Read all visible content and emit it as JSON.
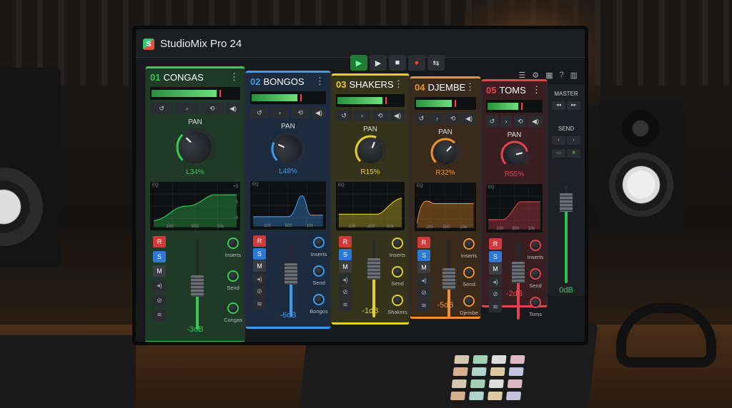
{
  "app": {
    "title": "StudioMix Pro 24",
    "logo_letter": "S"
  },
  "transport": {
    "play": "▶",
    "play2": "▶",
    "stop": "■",
    "record": "●",
    "loop": "⇆"
  },
  "top_icons": [
    "list-icon",
    "gear-icon",
    "layout-icon",
    "help-icon",
    "panels-icon"
  ],
  "channels": [
    {
      "num": "01",
      "name": "CONGAS",
      "color": "#35c956",
      "bg": "#1f3a27",
      "pan_label": "PAN",
      "pan_value": "L34%",
      "pan_level": 0.33,
      "meter_level": 0.72,
      "db": "-3dB",
      "knob_labels": [
        "Inserts",
        "Send",
        "Congas"
      ],
      "fader_level": 0.48,
      "eq_ticks": [
        "100",
        "500",
        "10k"
      ],
      "eq_right": [
        "+3",
        "0",
        "-3"
      ],
      "eq_label": "EQ",
      "rsm": [
        "R",
        "S",
        "M"
      ]
    },
    {
      "num": "02",
      "name": "BONGOS",
      "color": "#3d9bef",
      "bg": "#1d2b3e",
      "pan_label": "PAN",
      "pan_value": "L48%",
      "pan_level": 0.26,
      "meter_level": 0.6,
      "db": "-6dB",
      "knob_labels": [
        "Inserts",
        "Send",
        "Bongos"
      ],
      "fader_level": 0.55,
      "eq_ticks": [
        "100",
        "500",
        "10k"
      ],
      "eq_right": [],
      "eq_label": "EQ",
      "rsm": [
        "R",
        "S",
        "M"
      ]
    },
    {
      "num": "03",
      "name": "SHAKERS",
      "color": "#e6cf2b",
      "bg": "#34331c",
      "pan_label": "PAN",
      "pan_value": "R15%",
      "pan_level": 0.58,
      "meter_level": 0.66,
      "db": "-1dB",
      "knob_labels": [
        "Inserts",
        "Send",
        "Shakers"
      ],
      "fader_level": 0.62,
      "eq_ticks": [
        "100",
        "200",
        "10k"
      ],
      "eq_right": [],
      "eq_label": "EQ",
      "rsm": [
        "R",
        "S",
        "M"
      ]
    },
    {
      "num": "04",
      "name": "DJEMBE",
      "color": "#f0922f",
      "bg": "#3a2a1c",
      "pan_label": "PAN",
      "pan_value": "R32%",
      "pan_level": 0.66,
      "meter_level": 0.58,
      "db": "-5dB",
      "knob_labels": [
        "Inserts",
        "Send",
        "Djembe"
      ],
      "fader_level": 0.5,
      "eq_ticks": [
        "100",
        "500",
        "10k"
      ],
      "eq_right": [],
      "eq_label": "EQ",
      "rsm": [
        "R",
        "S",
        "M"
      ]
    },
    {
      "num": "05",
      "name": "TOMS",
      "color": "#e0444f",
      "bg": "#3a1f22",
      "pan_label": "PAN",
      "pan_value": "R55%",
      "pan_level": 0.78,
      "meter_level": 0.55,
      "db": "-2dB",
      "knob_labels": [
        "Inserts",
        "Send",
        "Toms"
      ],
      "fader_level": 0.6,
      "eq_ticks": [
        "100",
        "500",
        "10k"
      ],
      "eq_right": [],
      "eq_label": "EQ",
      "rsm": [
        "R",
        "S",
        "M"
      ]
    }
  ],
  "master": {
    "title": "MASTER",
    "send_label": "SEND",
    "db": "0dB",
    "fader_level": 0.82
  }
}
